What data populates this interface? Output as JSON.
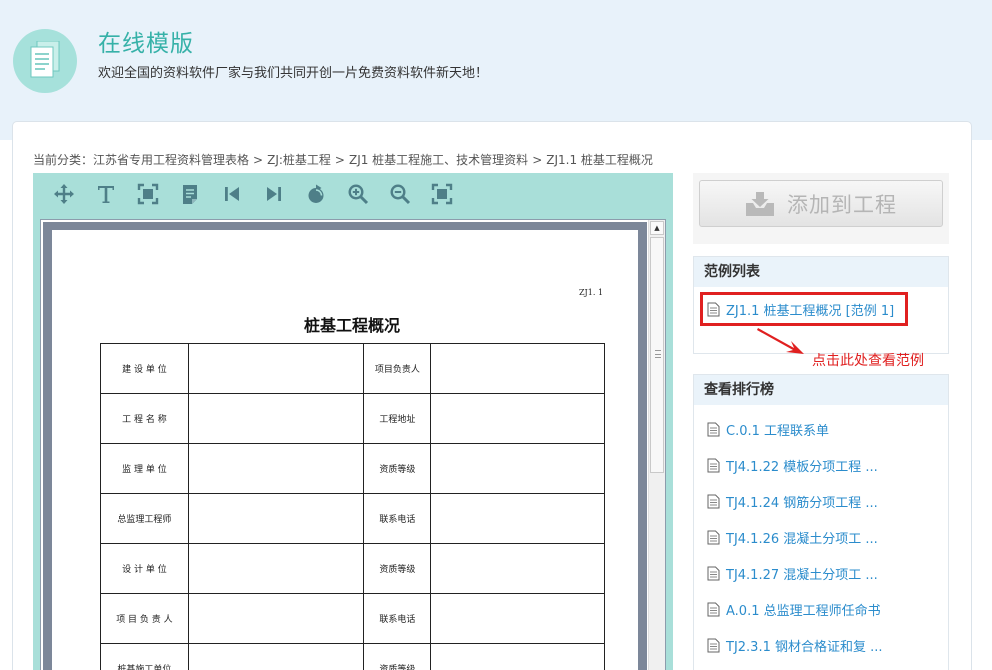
{
  "header": {
    "title": "在线模版",
    "subtitle": "欢迎全国的资料软件厂家与我们共同开创一片免费资料软件新天地！"
  },
  "breadcrumb": {
    "prefix": "当前分类：",
    "items": [
      "江苏省专用工程资料管理表格",
      "ZJ:桩基工程",
      "ZJ1 桩基工程施工、技术管理资料",
      "ZJ1.1 桩基工程概况"
    ],
    "separator": ">"
  },
  "toolbar": {
    "tools": [
      "move-icon",
      "text-icon",
      "fit-page-icon",
      "notes-icon",
      "first-page-icon",
      "last-page-icon",
      "rotate-icon",
      "zoom-in-icon",
      "zoom-out-icon",
      "fullscreen-icon"
    ]
  },
  "document": {
    "code": "ZJ1. 1",
    "title": "桩基工程概况",
    "rows": [
      {
        "label1": "建 设 单 位",
        "label2": "项目负责人"
      },
      {
        "label1": "工 程 名 称",
        "label2": "工程地址"
      },
      {
        "label1": "监 理 单 位",
        "label2": "资质等级"
      },
      {
        "label1": "总监理工程师",
        "label2": "联系电话"
      },
      {
        "label1": "设 计 单 位",
        "label2": "资质等级"
      },
      {
        "label1": "项 目 负 责 人",
        "label2": "联系电话"
      },
      {
        "label1": "桩基施工单位",
        "label2": "资质等级"
      }
    ]
  },
  "actions": {
    "add_label": "添加到工程"
  },
  "examples": {
    "heading": "范例列表",
    "items": [
      "ZJ1.1 桩基工程概况 [范例 1]"
    ]
  },
  "annotation": {
    "text": "点击此处查看范例",
    "color": "#e02020"
  },
  "ranking": {
    "heading": "查看排行榜",
    "items": [
      "C.0.1 工程联系单",
      "TJ4.1.22 模板分项工程 ...",
      "TJ4.1.24 钢筋分项工程 ...",
      "TJ4.1.26 混凝土分项工 ...",
      "TJ4.1.27 混凝土分项工 ...",
      "A.0.1 总监理工程师任命书",
      "TJ2.3.1 钢材合格证和复 ..."
    ]
  },
  "colors": {
    "accent": "#36b1a8",
    "link": "#2b8ccc",
    "header_bg": "#e8f2fa",
    "toolbar_bg": "#a9dfd9"
  }
}
